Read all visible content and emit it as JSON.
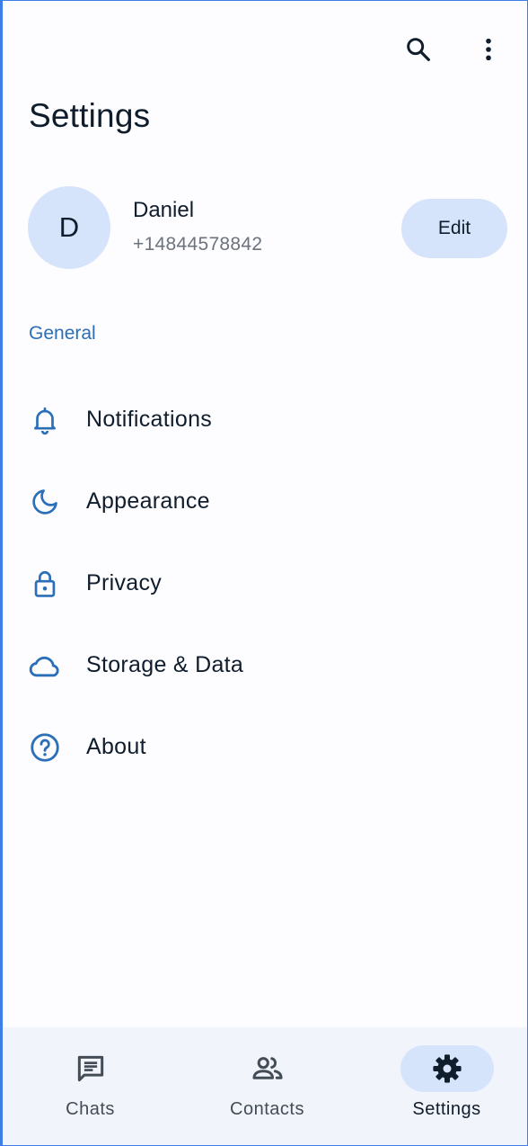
{
  "header": {
    "title": "Settings",
    "search_icon": "search-icon",
    "more_icon": "more-vert-icon"
  },
  "profile": {
    "avatar_initial": "D",
    "name": "Daniel",
    "phone": "+14844578842",
    "edit_label": "Edit"
  },
  "general": {
    "header": "General",
    "items": [
      {
        "label": "Notifications",
        "icon": "bell-icon"
      },
      {
        "label": "Appearance",
        "icon": "moon-icon"
      },
      {
        "label": "Privacy",
        "icon": "lock-icon"
      },
      {
        "label": "Storage & Data",
        "icon": "cloud-icon"
      },
      {
        "label": "About",
        "icon": "help-circle-icon"
      }
    ]
  },
  "bottom_nav": {
    "items": [
      {
        "label": "Chats",
        "icon": "chat-icon",
        "active": false
      },
      {
        "label": "Contacts",
        "icon": "people-icon",
        "active": false
      },
      {
        "label": "Settings",
        "icon": "gear-icon",
        "active": true
      }
    ]
  },
  "colors": {
    "accent": "#2a6fb7",
    "pill": "#d6e4fb",
    "background": "#fdfcff",
    "nav_background": "#f1f4fa"
  }
}
